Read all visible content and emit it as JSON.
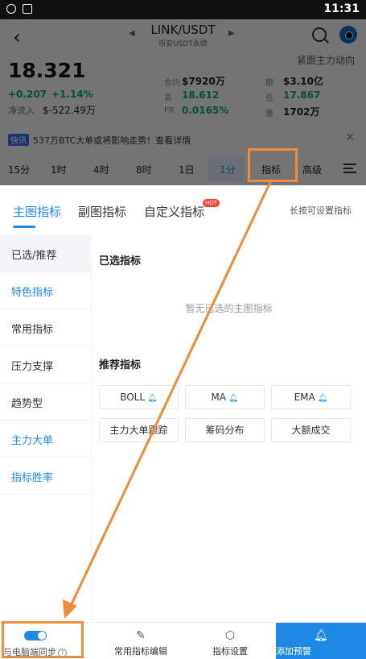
{
  "status_bar": {
    "time": "11:31"
  },
  "header": {
    "pair": "LINK/USDT",
    "exchange": "币安USDT永续"
  },
  "ticker": {
    "price": "18.321",
    "follow_label": "紧跟主力动向",
    "change_abs": "+0.207",
    "change_pct": "+1.14%",
    "net_inflow_label": "净流入",
    "net_inflow_value": "$-522.49万",
    "stats": [
      {
        "label": "合约",
        "value": "$7920万"
      },
      {
        "label": "额",
        "value": "$3.10亿"
      },
      {
        "label": "高",
        "value": "18.612"
      },
      {
        "label": "低",
        "value": "17.867"
      },
      {
        "label": "FR",
        "value": "0.0165%"
      },
      {
        "label": "量",
        "value": "1702万"
      }
    ]
  },
  "news": {
    "tag": "快讯",
    "text": "537万BTC大单或将影响走势！查看详情"
  },
  "timeframes": [
    "15分",
    "1时",
    "4时",
    "8时",
    "1日",
    "1分",
    "指标",
    "高级"
  ],
  "panel": {
    "tabs": [
      "主图指标",
      "副图指标",
      "自定义指标"
    ],
    "hot_badge": "HOT",
    "hint": "长按可设置指标",
    "sidebar": [
      "已选/推荐",
      "特色指标",
      "常用指标",
      "压力支撑",
      "趋势型",
      "主力大单",
      "指标胜率"
    ],
    "selected_title": "已选指标",
    "empty_text": "暂无已选的主图指标",
    "recommended_title": "推荐指标",
    "chips": [
      "BOLL",
      "MA",
      "EMA",
      "主力大单跟踪",
      "筹码分布",
      "大额成交"
    ]
  },
  "bottom_bar": {
    "sync_label": "与电脑端同步",
    "edit_label": "常用指标编辑",
    "settings_label": "指标设置",
    "alert_label": "添加预警"
  },
  "colors": {
    "accent": "#1e88e5",
    "annotation": "#f08a3c",
    "up": "#16a085"
  }
}
